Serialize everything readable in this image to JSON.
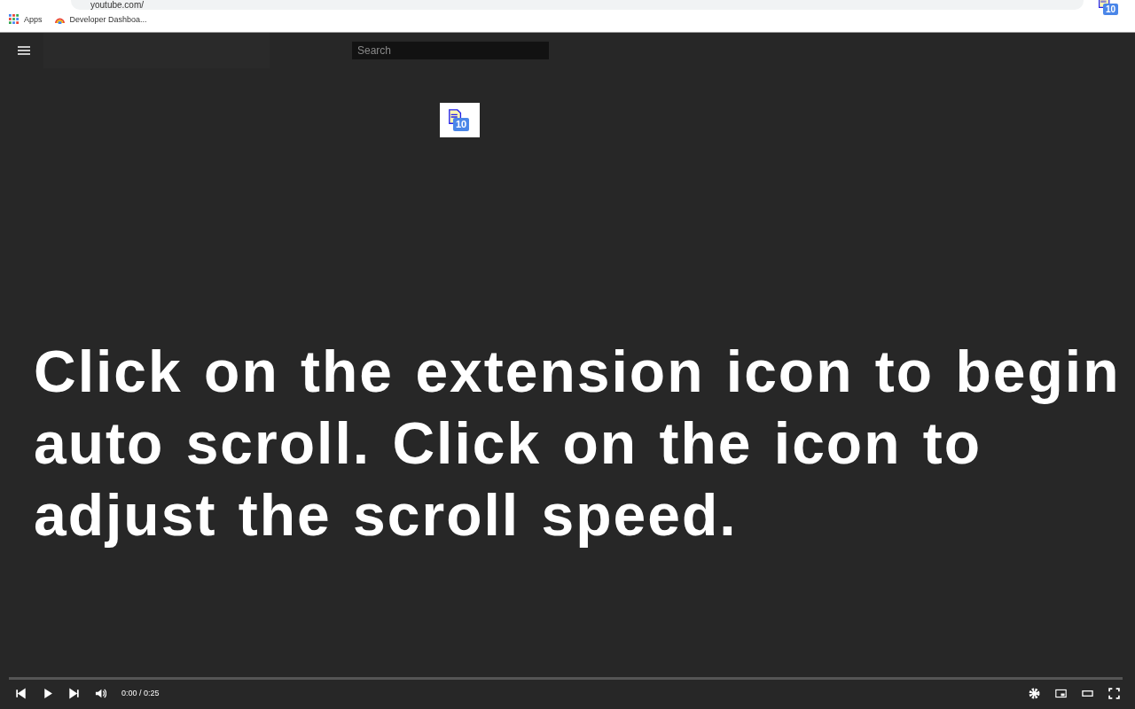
{
  "browser": {
    "address": "youtube.com/",
    "extension_badge": "10",
    "bookmarks": [
      {
        "label": "Apps",
        "kind": "apps"
      },
      {
        "label": "Developer Dashboa...",
        "kind": "site"
      }
    ]
  },
  "header": {
    "search": {
      "placeholder": "Search"
    }
  },
  "overlay_badge": "10",
  "caption": "Click on the extension icon to begin auto scroll. Click on the icon to adjust the scroll speed.",
  "player": {
    "time": "0:00 / 0:25"
  }
}
